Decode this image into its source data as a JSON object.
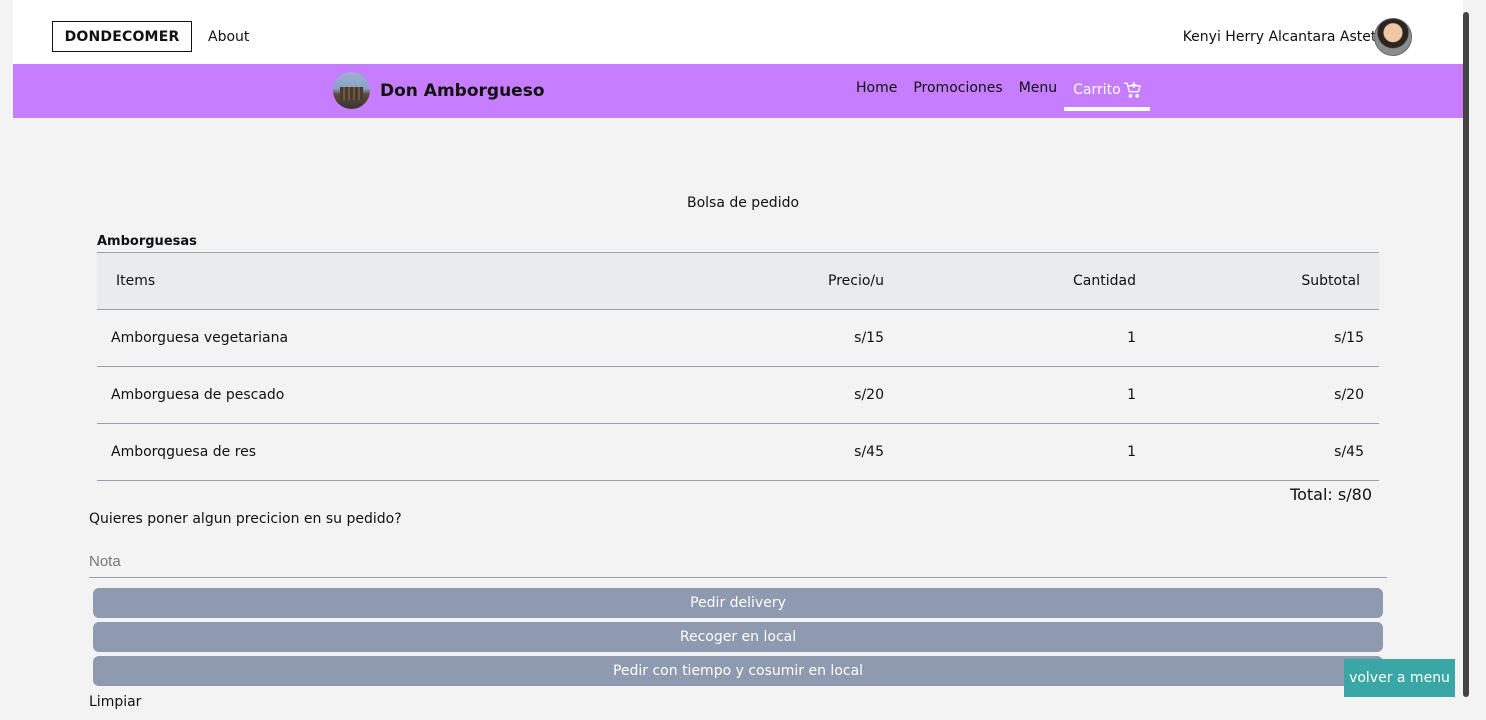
{
  "header": {
    "brand": "DONDECOMER",
    "about": "About",
    "user_name": "Kenyi Herry Alcantara Astete"
  },
  "navbar": {
    "store_name": "Don Amborgueso",
    "links": [
      "Home",
      "Promociones",
      "Menu",
      "Carrito"
    ],
    "active": "Carrito"
  },
  "cart": {
    "title": "Bolsa de pedido",
    "category": "Amborguesas",
    "columns": [
      "Items",
      "Precio/u",
      "Cantidad",
      "Subtotal"
    ],
    "rows": [
      {
        "item": "Amborguesa vegetariana",
        "price": "s/15",
        "qty": "1",
        "subtotal": "s/15"
      },
      {
        "item": "Amborguesa de pescado",
        "price": "s/20",
        "qty": "1",
        "subtotal": "s/20"
      },
      {
        "item": "Amborqguesa de res",
        "price": "s/45",
        "qty": "1",
        "subtotal": "s/45"
      }
    ],
    "total": "Total: s/80"
  },
  "form": {
    "question": "Quieres poner algun precicion en su pedido?",
    "note_placeholder": "Nota",
    "buttons": [
      "Pedir delivery",
      "Recoger en local",
      "Pedir con tiempo y cosumir en local"
    ],
    "clear": "Limpiar"
  },
  "floating": {
    "back_to_menu": "volver a menu"
  },
  "colors": {
    "navbar": "#c77dff",
    "buttons": "#8e9aaf",
    "back_button": "#3aa6a6"
  }
}
